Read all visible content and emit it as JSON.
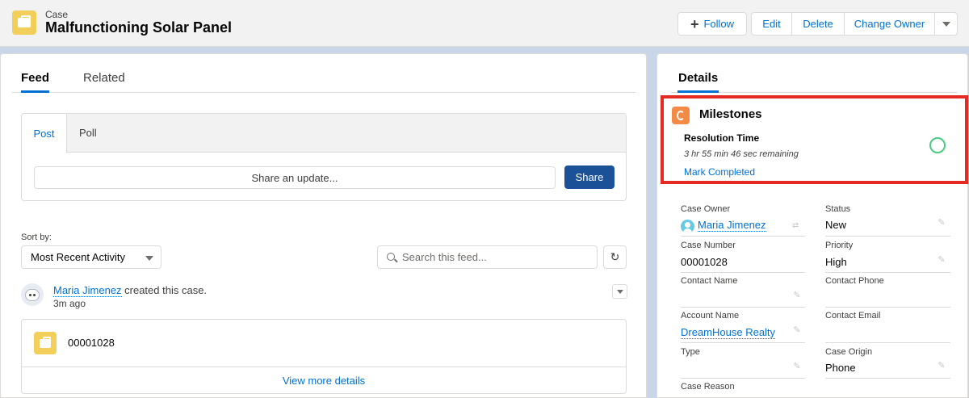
{
  "header": {
    "object_label": "Case",
    "title": "Malfunctioning Solar Panel",
    "buttons": {
      "follow": "Follow",
      "edit": "Edit",
      "delete": "Delete",
      "change_owner": "Change Owner"
    }
  },
  "left": {
    "tabs": {
      "feed": "Feed",
      "related": "Related"
    },
    "publisher": {
      "tab_post": "Post",
      "tab_poll": "Poll",
      "placeholder": "Share an update...",
      "share_button": "Share"
    },
    "sort_label": "Sort by:",
    "sort_value": "Most Recent Activity",
    "search_placeholder": "Search this feed...",
    "feed_item": {
      "actor": "Maria Jimenez",
      "action": " created this case.",
      "time": "3m ago",
      "case_number": "00001028",
      "view_more": "View more details"
    }
  },
  "right": {
    "tab": "Details",
    "milestones": {
      "title": "Milestones",
      "name": "Resolution Time",
      "remaining": "3 hr 55 min 46 sec remaining",
      "mark_completed": "Mark Completed"
    },
    "fields": {
      "case_owner_label": "Case Owner",
      "case_owner_value": "Maria Jimenez",
      "status_label": "Status",
      "status_value": "New",
      "case_number_label": "Case Number",
      "case_number_value": "00001028",
      "priority_label": "Priority",
      "priority_value": "High",
      "contact_name_label": "Contact Name",
      "contact_phone_label": "Contact Phone",
      "account_name_label": "Account Name",
      "account_name_value": "DreamHouse Realty",
      "contact_email_label": "Contact Email",
      "type_label": "Type",
      "case_origin_label": "Case Origin",
      "case_origin_value": "Phone",
      "case_reason_label": "Case Reason"
    }
  },
  "colors": {
    "brand": "#0070d2",
    "case_icon": "#f2cf5b",
    "milestone_icon": "#f38b46",
    "highlight": "#e32b24",
    "milestone_circle": "#4bca81"
  }
}
